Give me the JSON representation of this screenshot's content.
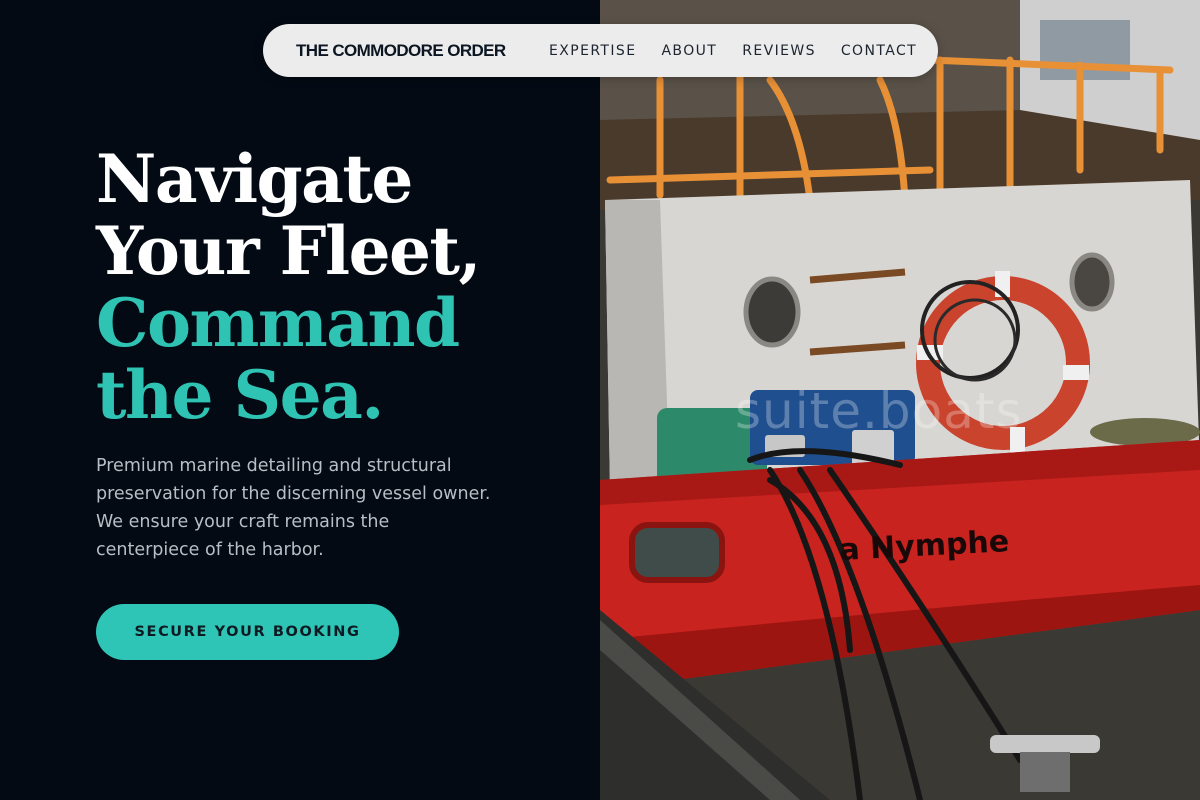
{
  "nav": {
    "brand": "THE COMMODORE ORDER",
    "links": [
      {
        "label": "EXPERTISE"
      },
      {
        "label": "ABOUT"
      },
      {
        "label": "REVIEWS"
      },
      {
        "label": "CONTACT"
      }
    ]
  },
  "hero": {
    "title_line1": "Navigate",
    "title_line2": "Your Fleet,",
    "title_line3": "Command",
    "title_line4": "the Sea.",
    "description": "Premium marine detailing and structural preservation for the discerning vessel owner. We ensure your craft remains the centerpiece of the harbor.",
    "cta_label": "SECURE YOUR BOOKING"
  },
  "image": {
    "boat_name": "a Nymphe",
    "watermark": "suite.boats"
  },
  "colors": {
    "background": "#030a13",
    "accent": "#2ec4b6",
    "nav_bg": "#ececec",
    "hull_red": "#c8231f"
  }
}
